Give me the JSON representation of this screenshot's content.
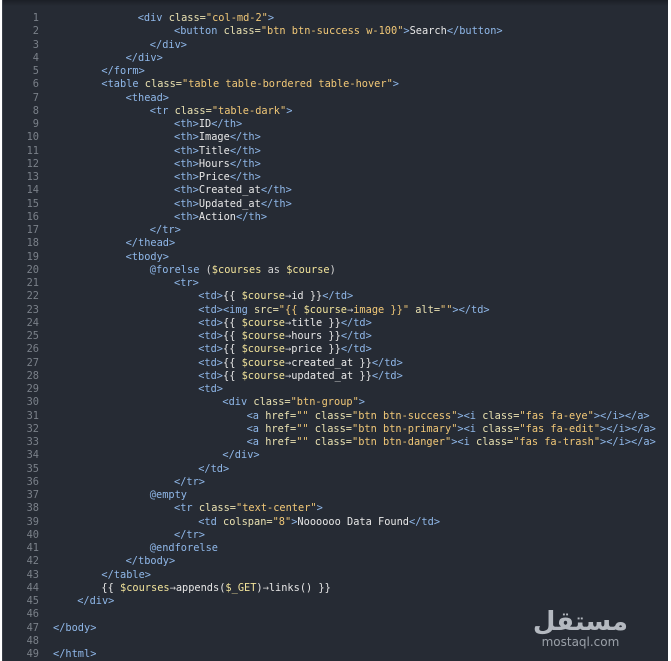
{
  "watermark": {
    "arabic": "مستقل",
    "latin": "mostaql.com"
  },
  "colors": {
    "tag": "#8fb7e8",
    "attr": "#e8e0b0",
    "string": "#f0c777",
    "text": "#e6e6e6",
    "variable": "#f0e29a",
    "background": "#262b34"
  },
  "lines": [
    {
      "n": "1",
      "indent": 14,
      "tokens": [
        [
          "tag",
          "<div "
        ],
        [
          "attr",
          "class="
        ],
        [
          "str",
          "\"col-md-2\""
        ],
        [
          "tag",
          ">"
        ]
      ]
    },
    {
      "n": "2",
      "indent": 20,
      "tokens": [
        [
          "tag",
          "<button "
        ],
        [
          "attr",
          "class="
        ],
        [
          "str",
          "\"btn btn-success w-100\""
        ],
        [
          "tag",
          ">"
        ],
        [
          "txt",
          "Search"
        ],
        [
          "tag",
          "</button>"
        ]
      ]
    },
    {
      "n": "3",
      "indent": 16,
      "tokens": [
        [
          "tag",
          "</div>"
        ]
      ]
    },
    {
      "n": "4",
      "indent": 12,
      "tokens": [
        [
          "tag",
          "</div>"
        ]
      ]
    },
    {
      "n": "5",
      "indent": 8,
      "tokens": [
        [
          "tag",
          "</form>"
        ]
      ]
    },
    {
      "n": "6",
      "indent": 8,
      "tokens": [
        [
          "tag",
          "<table "
        ],
        [
          "attr",
          "class="
        ],
        [
          "str",
          "\"table table-bordered table-hover\""
        ],
        [
          "tag",
          ">"
        ]
      ]
    },
    {
      "n": "7",
      "indent": 12,
      "tokens": [
        [
          "tag",
          "<thead>"
        ]
      ]
    },
    {
      "n": "8",
      "indent": 16,
      "tokens": [
        [
          "tag",
          "<tr "
        ],
        [
          "attr",
          "class="
        ],
        [
          "str",
          "\"table-dark\""
        ],
        [
          "tag",
          ">"
        ]
      ]
    },
    {
      "n": "9",
      "indent": 20,
      "tokens": [
        [
          "tag",
          "<th>"
        ],
        [
          "txt",
          "ID"
        ],
        [
          "tag",
          "</th>"
        ]
      ]
    },
    {
      "n": "10",
      "indent": 20,
      "tokens": [
        [
          "tag",
          "<th>"
        ],
        [
          "txt",
          "Image"
        ],
        [
          "tag",
          "</th>"
        ]
      ]
    },
    {
      "n": "11",
      "indent": 20,
      "tokens": [
        [
          "tag",
          "<th>"
        ],
        [
          "txt",
          "Title"
        ],
        [
          "tag",
          "</th>"
        ]
      ]
    },
    {
      "n": "12",
      "indent": 20,
      "tokens": [
        [
          "tag",
          "<th>"
        ],
        [
          "txt",
          "Hours"
        ],
        [
          "tag",
          "</th>"
        ]
      ]
    },
    {
      "n": "13",
      "indent": 20,
      "tokens": [
        [
          "tag",
          "<th>"
        ],
        [
          "txt",
          "Price"
        ],
        [
          "tag",
          "</th>"
        ]
      ]
    },
    {
      "n": "14",
      "indent": 20,
      "tokens": [
        [
          "tag",
          "<th>"
        ],
        [
          "txt",
          "Created_at"
        ],
        [
          "tag",
          "</th>"
        ]
      ]
    },
    {
      "n": "15",
      "indent": 20,
      "tokens": [
        [
          "tag",
          "<th>"
        ],
        [
          "txt",
          "Updated_at"
        ],
        [
          "tag",
          "</th>"
        ]
      ]
    },
    {
      "n": "16",
      "indent": 20,
      "tokens": [
        [
          "tag",
          "<th>"
        ],
        [
          "txt",
          "Action"
        ],
        [
          "tag",
          "</th>"
        ]
      ]
    },
    {
      "n": "17",
      "indent": 16,
      "tokens": [
        [
          "tag",
          "</tr>"
        ]
      ]
    },
    {
      "n": "18",
      "indent": 12,
      "tokens": [
        [
          "tag",
          "</thead>"
        ]
      ]
    },
    {
      "n": "19",
      "indent": 12,
      "tokens": [
        [
          "tag",
          "<tbody>"
        ]
      ]
    },
    {
      "n": "20",
      "indent": 16,
      "tokens": [
        [
          "blade",
          "@forelse "
        ],
        [
          "plain",
          "("
        ],
        [
          "var",
          "$courses"
        ],
        [
          "plain",
          " as "
        ],
        [
          "var",
          "$course"
        ],
        [
          "plain",
          ")"
        ]
      ]
    },
    {
      "n": "21",
      "indent": 20,
      "tokens": [
        [
          "tag",
          "<tr>"
        ]
      ]
    },
    {
      "n": "22",
      "indent": 24,
      "tokens": [
        [
          "tag",
          "<td>"
        ],
        [
          "txt",
          "{{ "
        ],
        [
          "var",
          "$course"
        ],
        [
          "op",
          "→"
        ],
        [
          "txt",
          "id }}"
        ],
        [
          "tag",
          "</td>"
        ]
      ]
    },
    {
      "n": "23",
      "indent": 24,
      "tokens": [
        [
          "tag",
          "<td><img "
        ],
        [
          "attr",
          "src="
        ],
        [
          "str",
          "\"{{ "
        ],
        [
          "var",
          "$course"
        ],
        [
          "op",
          "→"
        ],
        [
          "str",
          "image }}\""
        ],
        [
          "attr",
          " alt="
        ],
        [
          "str",
          "\"\""
        ],
        [
          "tag",
          "></td>"
        ]
      ]
    },
    {
      "n": "24",
      "indent": 24,
      "tokens": [
        [
          "tag",
          "<td>"
        ],
        [
          "txt",
          "{{ "
        ],
        [
          "var",
          "$course"
        ],
        [
          "op",
          "→"
        ],
        [
          "txt",
          "title }}"
        ],
        [
          "tag",
          "</td>"
        ]
      ]
    },
    {
      "n": "25",
      "indent": 24,
      "tokens": [
        [
          "tag",
          "<td>"
        ],
        [
          "txt",
          "{{ "
        ],
        [
          "var",
          "$course"
        ],
        [
          "op",
          "→"
        ],
        [
          "txt",
          "hours }}"
        ],
        [
          "tag",
          "</td>"
        ]
      ]
    },
    {
      "n": "26",
      "indent": 24,
      "tokens": [
        [
          "tag",
          "<td>"
        ],
        [
          "txt",
          "{{ "
        ],
        [
          "var",
          "$course"
        ],
        [
          "op",
          "→"
        ],
        [
          "txt",
          "price }}"
        ],
        [
          "tag",
          "</td>"
        ]
      ]
    },
    {
      "n": "27",
      "indent": 24,
      "tokens": [
        [
          "tag",
          "<td>"
        ],
        [
          "txt",
          "{{ "
        ],
        [
          "var",
          "$course"
        ],
        [
          "op",
          "→"
        ],
        [
          "txt",
          "created_at }}"
        ],
        [
          "tag",
          "</td>"
        ]
      ]
    },
    {
      "n": "28",
      "indent": 24,
      "tokens": [
        [
          "tag",
          "<td>"
        ],
        [
          "txt",
          "{{ "
        ],
        [
          "var",
          "$course"
        ],
        [
          "op",
          "→"
        ],
        [
          "txt",
          "updated_at }}"
        ],
        [
          "tag",
          "</td>"
        ]
      ]
    },
    {
      "n": "29",
      "indent": 24,
      "tokens": [
        [
          "tag",
          "<td>"
        ]
      ]
    },
    {
      "n": "30",
      "indent": 28,
      "tokens": [
        [
          "tag",
          "<div "
        ],
        [
          "attr",
          "class="
        ],
        [
          "str",
          "\"btn-group\""
        ],
        [
          "tag",
          ">"
        ]
      ]
    },
    {
      "n": "31",
      "indent": 32,
      "tokens": [
        [
          "tag",
          "<a "
        ],
        [
          "attr",
          "href="
        ],
        [
          "str",
          "\"\""
        ],
        [
          "attr",
          " class="
        ],
        [
          "str",
          "\"btn btn-success\""
        ],
        [
          "tag",
          ">"
        ],
        [
          "tag",
          "<i "
        ],
        [
          "attr",
          "class="
        ],
        [
          "str",
          "\"fas fa-eye\""
        ],
        [
          "tag",
          "></i></a>"
        ]
      ]
    },
    {
      "n": "32",
      "indent": 32,
      "tokens": [
        [
          "tag",
          "<a "
        ],
        [
          "attr",
          "href="
        ],
        [
          "str",
          "\"\""
        ],
        [
          "attr",
          " class="
        ],
        [
          "str",
          "\"btn btn-primary\""
        ],
        [
          "tag",
          ">"
        ],
        [
          "tag",
          "<i "
        ],
        [
          "attr",
          "class="
        ],
        [
          "str",
          "\"fas fa-edit\""
        ],
        [
          "tag",
          "></i></a>"
        ]
      ]
    },
    {
      "n": "33",
      "indent": 32,
      "tokens": [
        [
          "tag",
          "<a "
        ],
        [
          "attr",
          "href="
        ],
        [
          "str",
          "\"\""
        ],
        [
          "attr",
          " class="
        ],
        [
          "str",
          "\"btn btn-danger\""
        ],
        [
          "tag",
          ">"
        ],
        [
          "tag",
          "<i "
        ],
        [
          "attr",
          "class="
        ],
        [
          "str",
          "\"fas fa-trash\""
        ],
        [
          "tag",
          "></i></a>"
        ]
      ]
    },
    {
      "n": "34",
      "indent": 28,
      "tokens": [
        [
          "tag",
          "</div>"
        ]
      ]
    },
    {
      "n": "35",
      "indent": 24,
      "tokens": [
        [
          "tag",
          "</td>"
        ]
      ]
    },
    {
      "n": "36",
      "indent": 20,
      "tokens": [
        [
          "tag",
          "</tr>"
        ]
      ]
    },
    {
      "n": "37",
      "indent": 16,
      "tokens": [
        [
          "blade",
          "@empty"
        ]
      ]
    },
    {
      "n": "38",
      "indent": 20,
      "tokens": [
        [
          "tag",
          "<tr "
        ],
        [
          "attr",
          "class="
        ],
        [
          "str",
          "\"text-center\""
        ],
        [
          "tag",
          ">"
        ]
      ]
    },
    {
      "n": "39",
      "indent": 24,
      "tokens": [
        [
          "tag",
          "<td "
        ],
        [
          "attr",
          "colspan="
        ],
        [
          "str",
          "\"8\""
        ],
        [
          "tag",
          ">"
        ],
        [
          "txt",
          "Noooooo Data Found"
        ],
        [
          "tag",
          "</td>"
        ]
      ]
    },
    {
      "n": "40",
      "indent": 20,
      "tokens": [
        [
          "tag",
          "</tr>"
        ]
      ]
    },
    {
      "n": "41",
      "indent": 16,
      "tokens": [
        [
          "blade",
          "@endforelse"
        ]
      ]
    },
    {
      "n": "42",
      "indent": 12,
      "tokens": [
        [
          "tag",
          "</tbody>"
        ]
      ]
    },
    {
      "n": "43",
      "indent": 8,
      "tokens": [
        [
          "tag",
          "</table>"
        ]
      ]
    },
    {
      "n": "44",
      "indent": 8,
      "tokens": [
        [
          "txt",
          "{{ "
        ],
        [
          "var",
          "$courses"
        ],
        [
          "op",
          "→"
        ],
        [
          "txt",
          "appends("
        ],
        [
          "var",
          "$_GET"
        ],
        [
          "txt",
          ")"
        ],
        [
          "op",
          "→"
        ],
        [
          "txt",
          "links() }}"
        ]
      ]
    },
    {
      "n": "45",
      "indent": 4,
      "tokens": [
        [
          "tag",
          "</div>"
        ]
      ]
    },
    {
      "n": "46",
      "indent": 0,
      "tokens": []
    },
    {
      "n": "47",
      "indent": 0,
      "tokens": [
        [
          "tag",
          "</body>"
        ]
      ]
    },
    {
      "n": "48",
      "indent": 0,
      "tokens": []
    },
    {
      "n": "49",
      "indent": 0,
      "tokens": [
        [
          "tag",
          "</html>"
        ]
      ]
    }
  ]
}
